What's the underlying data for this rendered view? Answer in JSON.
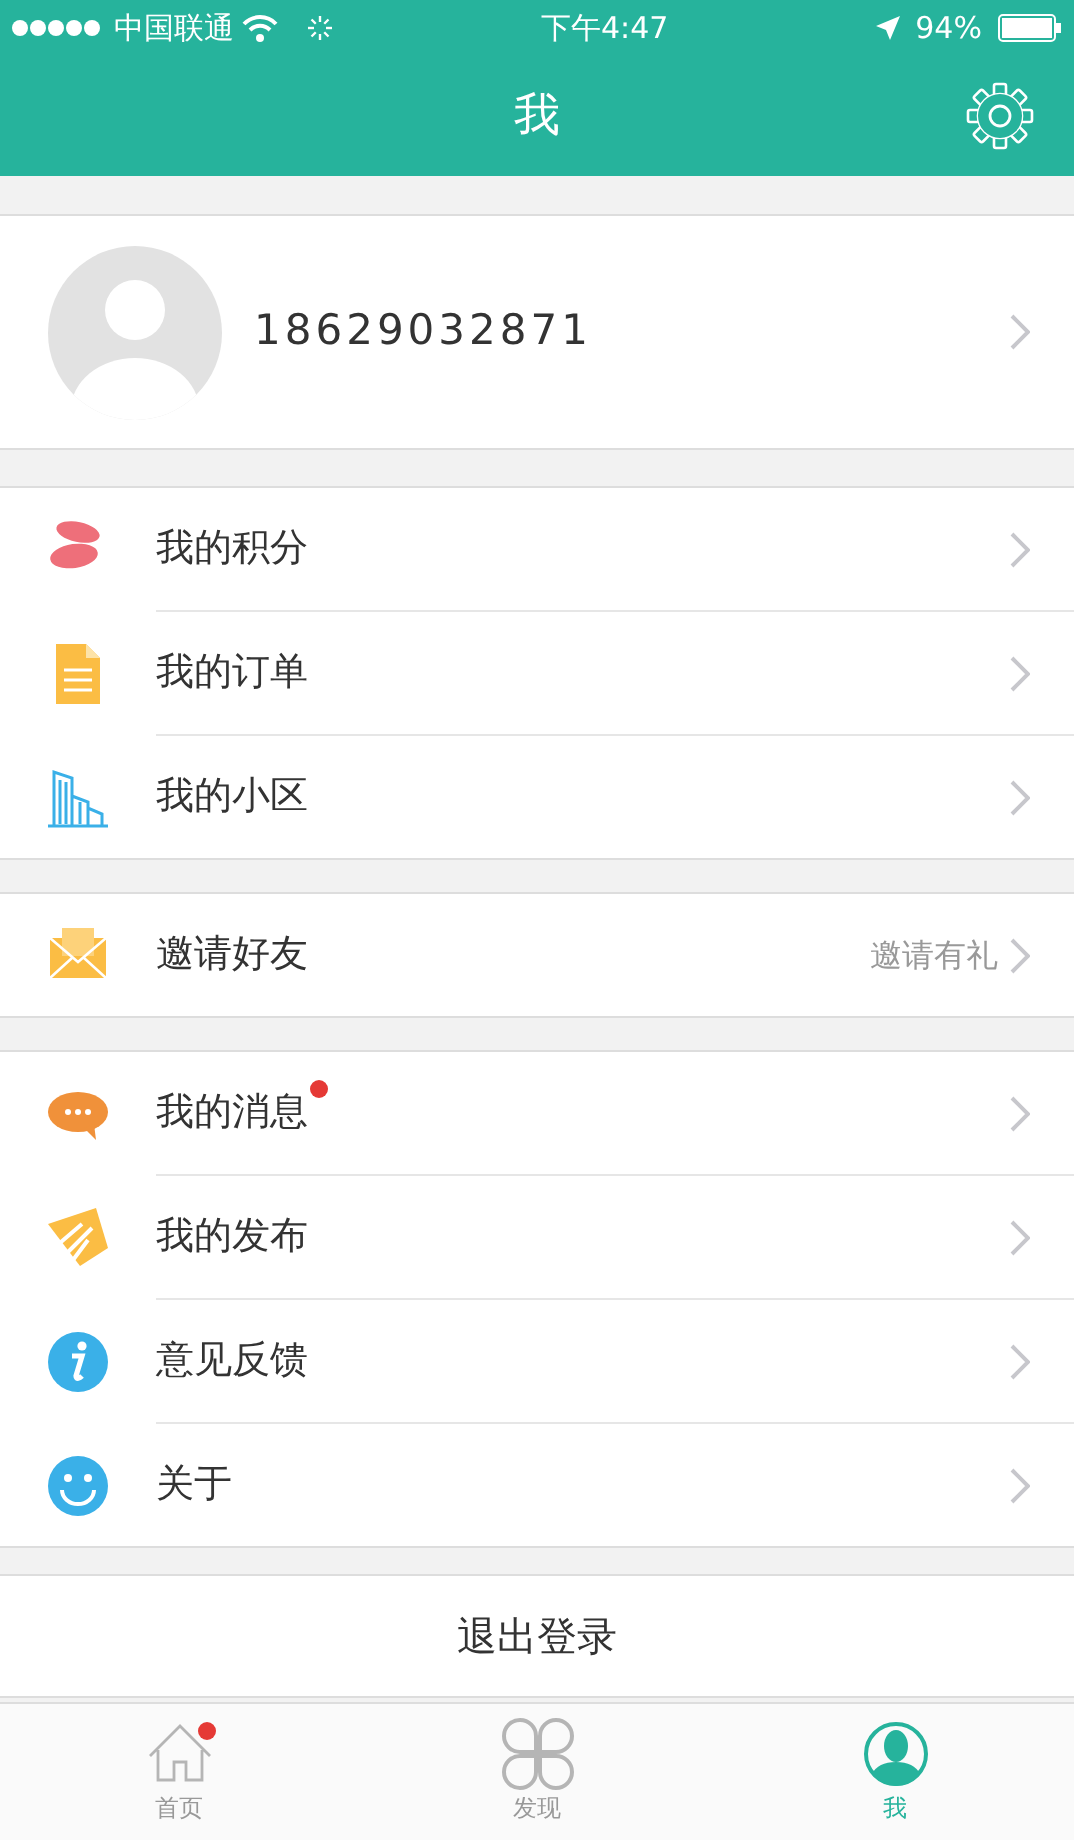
{
  "status_bar": {
    "carrier": "中国联通",
    "time": "下午4:47",
    "battery": "94%"
  },
  "header": {
    "title": "我"
  },
  "profile": {
    "phone": "18629032871"
  },
  "menu_groups": [
    [
      {
        "kind": "points",
        "label": "我的积分",
        "unread": false
      },
      {
        "kind": "orders",
        "label": "我的订单",
        "unread": false
      },
      {
        "kind": "community",
        "label": "我的小区",
        "unread": false
      }
    ],
    [
      {
        "kind": "invite",
        "label": "邀请好友",
        "value": "邀请有礼",
        "unread": false
      }
    ],
    [
      {
        "kind": "messages",
        "label": "我的消息",
        "unread": true
      },
      {
        "kind": "posts",
        "label": "我的发布",
        "unread": false
      },
      {
        "kind": "feedback",
        "label": "意见反馈",
        "unread": false
      },
      {
        "kind": "about",
        "label": "关于",
        "unread": false
      }
    ]
  ],
  "logout": "退出登录",
  "tab_bar": [
    {
      "kind": "home",
      "label": "首页",
      "selected": false,
      "unread": true
    },
    {
      "kind": "discover",
      "label": "发现",
      "selected": false,
      "unread": false
    },
    {
      "kind": "me",
      "label": "我",
      "selected": true,
      "unread": false
    }
  ]
}
